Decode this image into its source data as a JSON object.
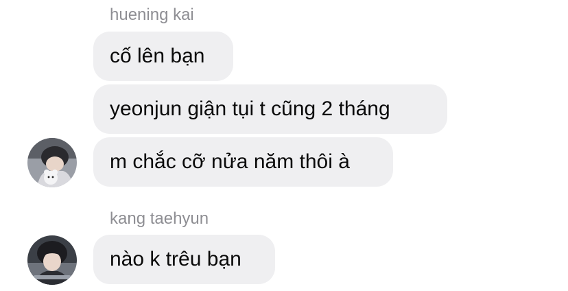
{
  "messages": [
    {
      "sender": "huening kai",
      "avatar": "profile-photo-avatar",
      "bubbles": [
        "cố lên bạn",
        "yeonjun giận tụi t cũng 2 tháng",
        "m chắc cỡ nửa năm thôi à"
      ]
    },
    {
      "sender": "kang taehyun",
      "avatar": "profile-photo-avatar",
      "bubbles": [
        "nào k trêu bạn"
      ]
    }
  ],
  "colors": {
    "bubble_bg": "#efeff1",
    "sender_text": "#8e8e93",
    "message_text": "#0a0a0a",
    "background": "#ffffff"
  }
}
